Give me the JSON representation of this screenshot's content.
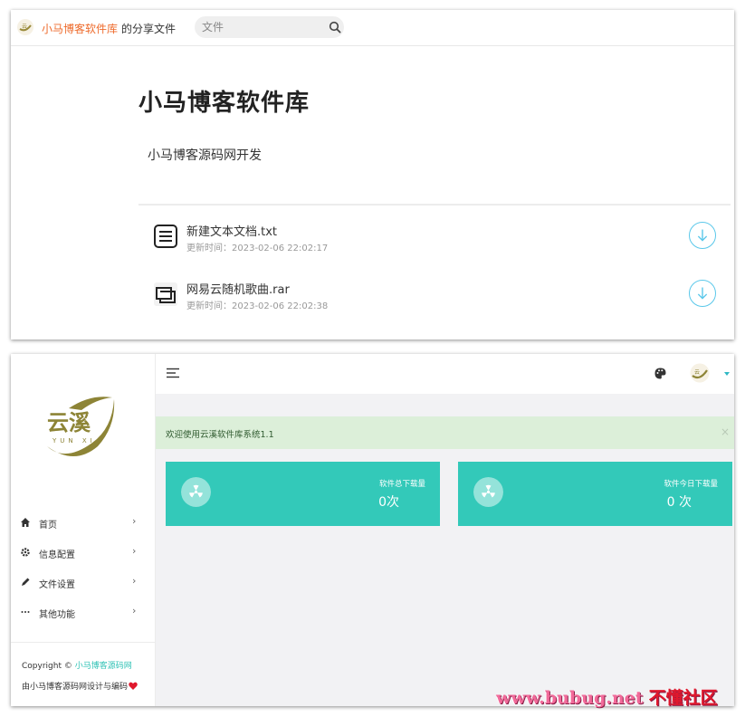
{
  "share_page": {
    "brand_name": "小马博客软件库",
    "brand_suffix": "的分享文件",
    "search_placeholder": "文件",
    "title": "小马博客软件库",
    "description": "小马博客源码网开发",
    "files": [
      {
        "name": "新建文本文档.txt",
        "time": "更新时间：2023-02-06 22:02:17",
        "icon": "text-file-icon"
      },
      {
        "name": "网易云随机歌曲.rar",
        "time": "更新时间：2023-02-06 22:02:38",
        "icon": "archive-file-icon"
      }
    ]
  },
  "admin": {
    "logo_text": "云溪",
    "logo_sub": "YUN XI",
    "nav": [
      {
        "label": "首页",
        "icon": "home-icon"
      },
      {
        "label": "信息配置",
        "icon": "gear-icon"
      },
      {
        "label": "文件设置",
        "icon": "pencil-icon"
      },
      {
        "label": "其他功能",
        "icon": "more-icon"
      }
    ],
    "copyright_prefix": "Copyright ©",
    "copyright_link": "小马博客源码网",
    "credit": "由小马博客源码网设计与编码",
    "notice": "欢迎使用云溪软件库系统1.1",
    "notice_close": "×",
    "stats": [
      {
        "label": "软件总下载量",
        "value": "0次"
      },
      {
        "label": "软件今日下载量",
        "value": "0 次"
      }
    ],
    "accent_color": "#33c9b9"
  },
  "watermark": {
    "domain": "www.bubug.net",
    "brand": "不懂社区"
  }
}
